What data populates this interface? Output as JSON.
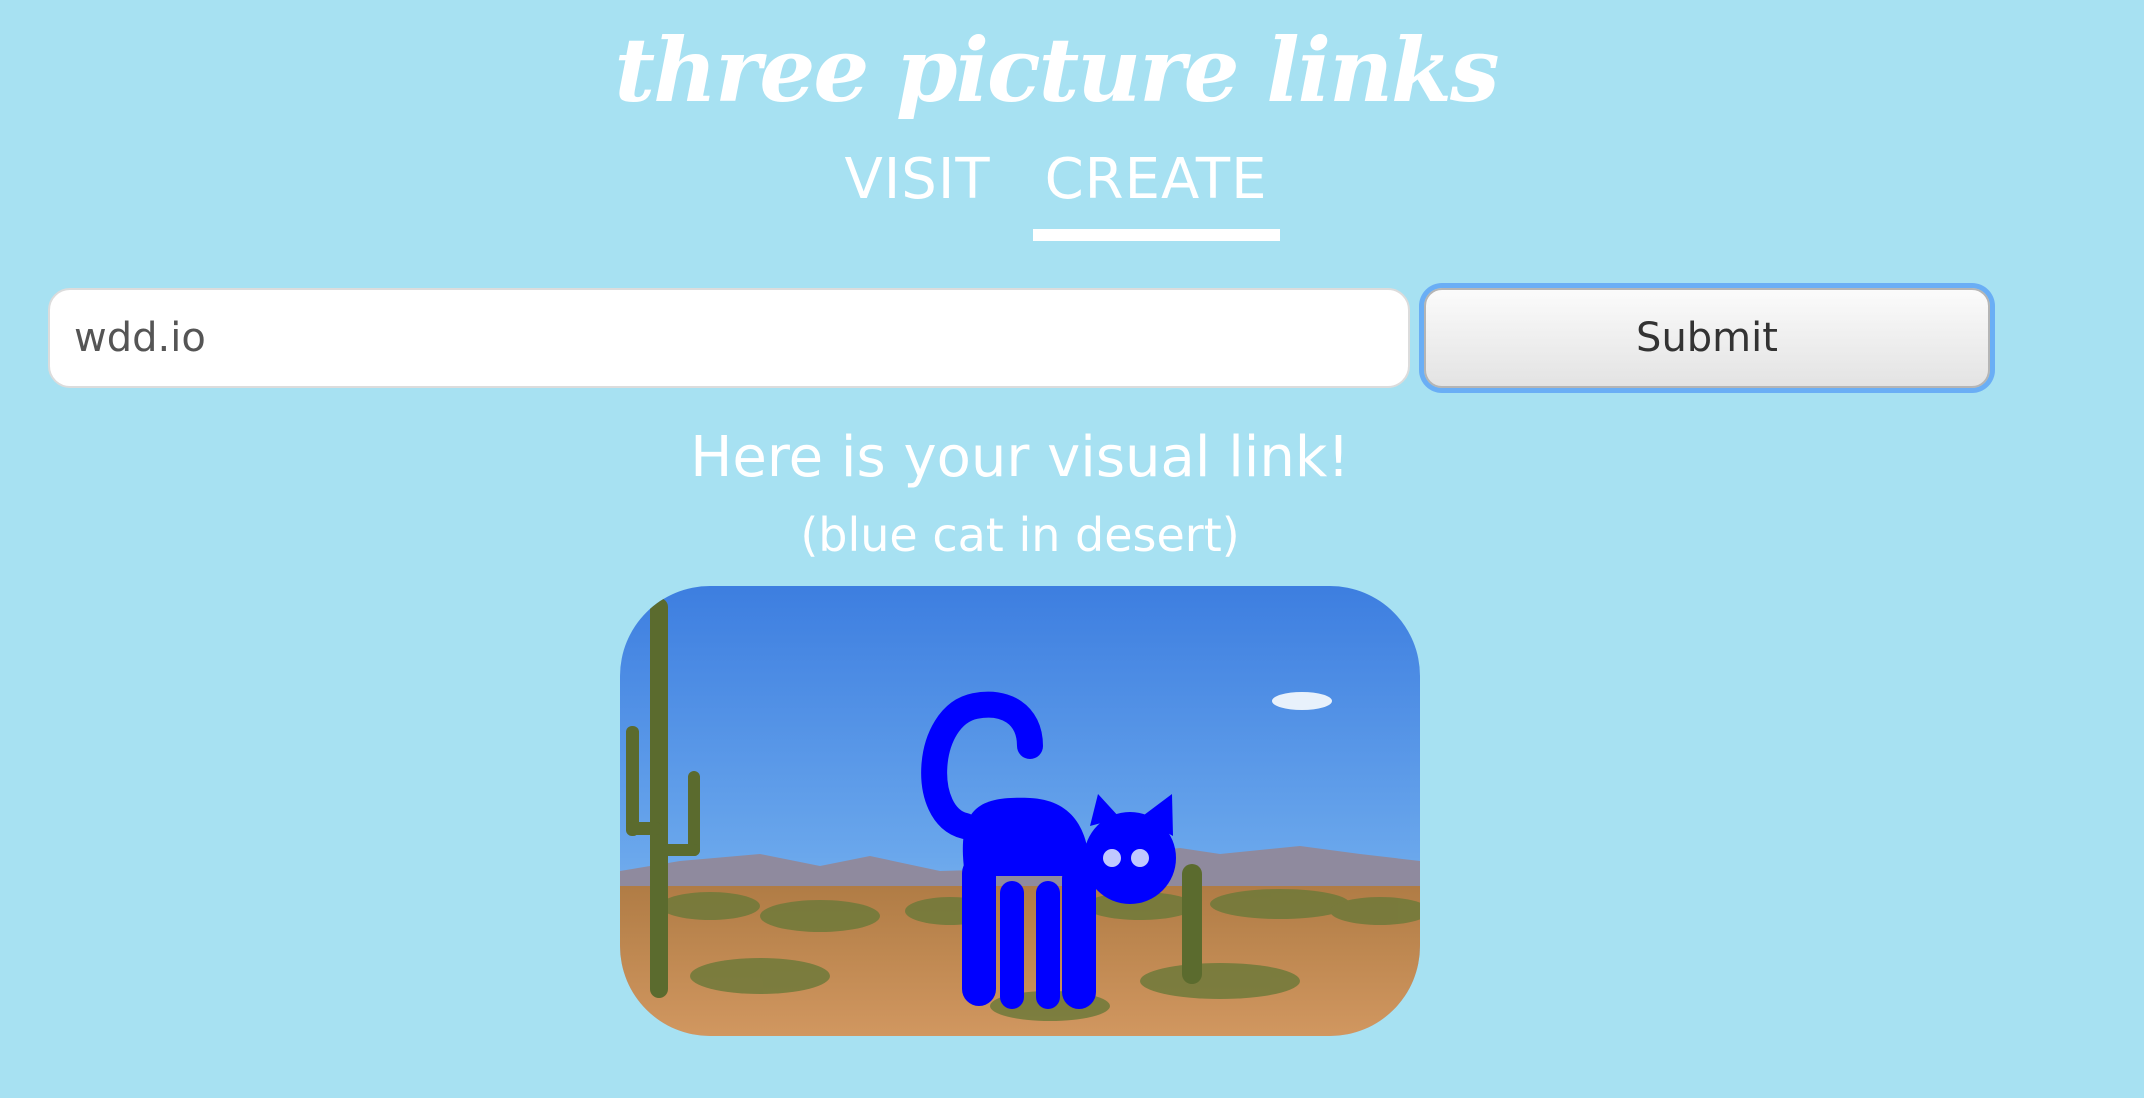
{
  "header": {
    "title": "three picture links"
  },
  "nav": {
    "visit_label": "VISIT",
    "create_label": "CREATE",
    "active_tab": "CREATE"
  },
  "form": {
    "url_value": "wdd.io",
    "submit_label": "Submit"
  },
  "result": {
    "heading": "Here is your visual link!",
    "caption": "(blue cat in desert)",
    "image_subject": "blue cat standing in a desert with saguaro cactus"
  },
  "colors": {
    "background": "#a7e1f2",
    "text": "#ffffff",
    "cat": "#0000ff",
    "focus_ring": "#6aaef5"
  }
}
